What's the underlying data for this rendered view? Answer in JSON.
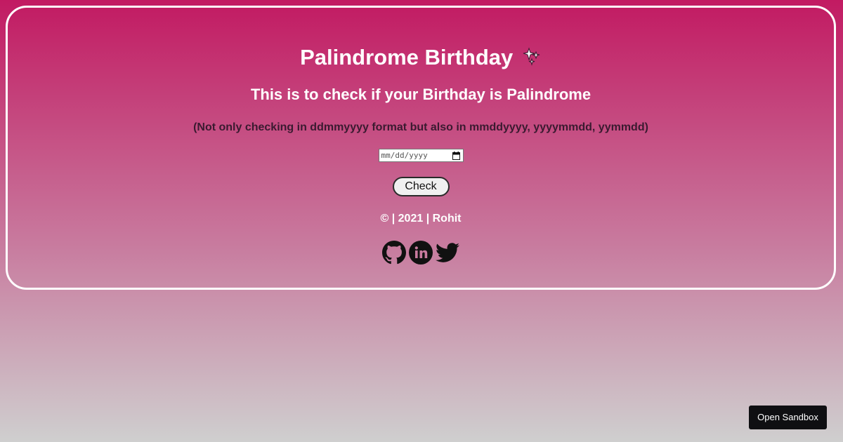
{
  "header": {
    "title": "Palindrome Birthday",
    "title_emoji": "sparkles-icon",
    "subtitle": "This is to check if your Birthday is Palindrome",
    "note": "(Not only checking in ddmmyyyy format but also in mmddyyyy, yyyymmdd, yymmdd)"
  },
  "form": {
    "date_placeholder": "mm/dd/yyyy",
    "check_label": "Check"
  },
  "footer": {
    "text": "© | 2021 | Rohit",
    "socials": [
      "github-icon",
      "linkedin-icon",
      "twitter-icon"
    ]
  },
  "sandbox": {
    "label": "Open Sandbox"
  },
  "colors": {
    "gradient_top": "#c21a62",
    "gradient_bottom": "#cfcfcf",
    "card_border": "#ffffff",
    "note_text": "#3a1a30"
  }
}
